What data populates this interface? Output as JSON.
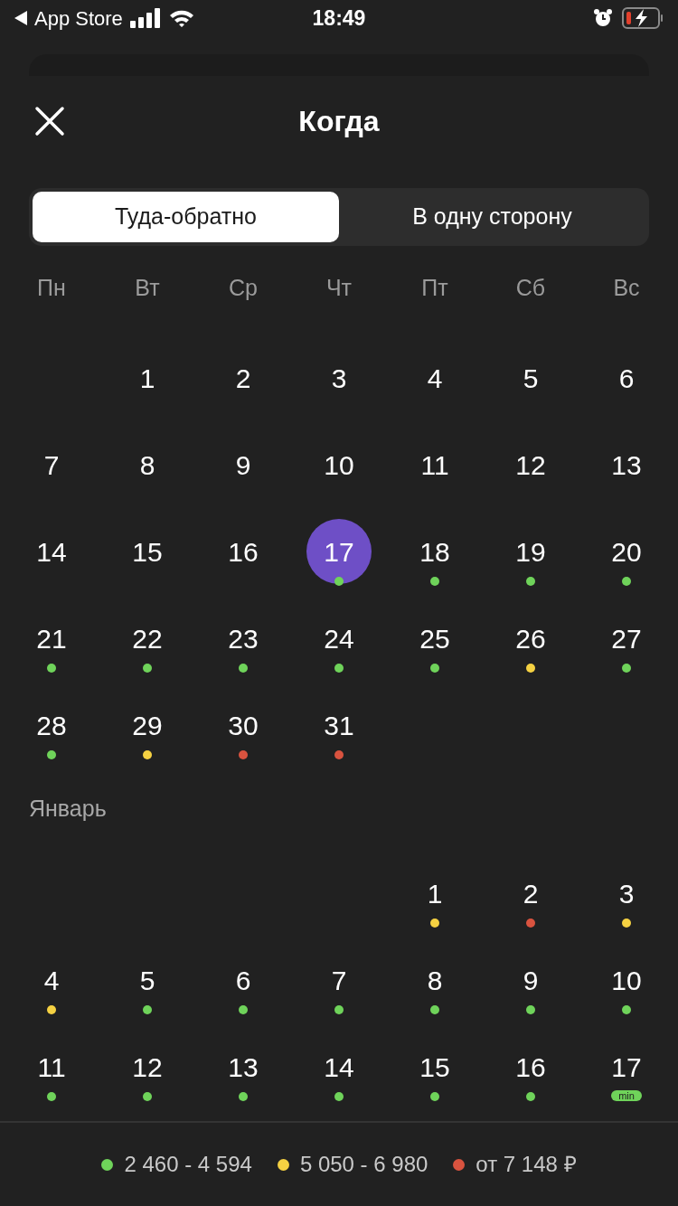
{
  "status_bar": {
    "back_label": "App Store",
    "time": "18:49"
  },
  "header": {
    "title": "Когда"
  },
  "trip_tabs": [
    {
      "label": "Туда-обратно",
      "selected": true
    },
    {
      "label": "В одну сторону",
      "selected": false
    }
  ],
  "weekdays": [
    "Пн",
    "Вт",
    "Ср",
    "Чт",
    "Пт",
    "Сб",
    "Вс"
  ],
  "months": [
    {
      "days": [
        {
          "kind": "blank"
        },
        {
          "kind": "day",
          "day": "1",
          "selected": false
        },
        {
          "kind": "day",
          "day": "2",
          "selected": false
        },
        {
          "kind": "day",
          "day": "3",
          "selected": false
        },
        {
          "kind": "day",
          "day": "4",
          "selected": false
        },
        {
          "kind": "day",
          "day": "5",
          "selected": false
        },
        {
          "kind": "day",
          "day": "6",
          "selected": false
        },
        {
          "kind": "day",
          "day": "7",
          "selected": false
        },
        {
          "kind": "day",
          "day": "8",
          "selected": false
        },
        {
          "kind": "day",
          "day": "9",
          "selected": false
        },
        {
          "kind": "day",
          "day": "10",
          "selected": false
        },
        {
          "kind": "day",
          "day": "11",
          "selected": false
        },
        {
          "kind": "day",
          "day": "12",
          "selected": false
        },
        {
          "kind": "day",
          "day": "13",
          "selected": false
        },
        {
          "kind": "day",
          "day": "14",
          "selected": false
        },
        {
          "kind": "day",
          "day": "15",
          "selected": false
        },
        {
          "kind": "day",
          "day": "16",
          "selected": false
        },
        {
          "kind": "day",
          "day": "17",
          "selected": true,
          "color": "#6fd35a"
        },
        {
          "kind": "day",
          "day": "18",
          "selected": false,
          "color": "#6fd35a"
        },
        {
          "kind": "day",
          "day": "19",
          "selected": false,
          "color": "#6fd35a"
        },
        {
          "kind": "day",
          "day": "20",
          "selected": false,
          "color": "#6fd35a"
        },
        {
          "kind": "day",
          "day": "21",
          "selected": false,
          "color": "#6fd35a"
        },
        {
          "kind": "day",
          "day": "22",
          "selected": false,
          "color": "#6fd35a"
        },
        {
          "kind": "day",
          "day": "23",
          "selected": false,
          "color": "#6fd35a"
        },
        {
          "kind": "day",
          "day": "24",
          "selected": false,
          "color": "#6fd35a"
        },
        {
          "kind": "day",
          "day": "25",
          "selected": false,
          "color": "#6fd35a"
        },
        {
          "kind": "day",
          "day": "26",
          "selected": false,
          "color": "#f5d142"
        },
        {
          "kind": "day",
          "day": "27",
          "selected": false,
          "color": "#6fd35a"
        },
        {
          "kind": "day",
          "day": "28",
          "selected": false,
          "color": "#6fd35a"
        },
        {
          "kind": "day",
          "day": "29",
          "selected": false,
          "color": "#f5d142"
        },
        {
          "kind": "day",
          "day": "30",
          "selected": false,
          "color": "#d9533f"
        },
        {
          "kind": "day",
          "day": "31",
          "selected": false,
          "color": "#d9533f"
        }
      ]
    },
    {
      "title": "Январь",
      "days": [
        {
          "kind": "blank"
        },
        {
          "kind": "blank"
        },
        {
          "kind": "blank"
        },
        {
          "kind": "blank"
        },
        {
          "kind": "day",
          "day": "1",
          "selected": false,
          "color": "#f5d142"
        },
        {
          "kind": "day",
          "day": "2",
          "selected": false,
          "color": "#d9533f"
        },
        {
          "kind": "day",
          "day": "3",
          "selected": false,
          "color": "#f5d142"
        },
        {
          "kind": "day",
          "day": "4",
          "selected": false,
          "color": "#f5d142"
        },
        {
          "kind": "day",
          "day": "5",
          "selected": false,
          "color": "#6fd35a"
        },
        {
          "kind": "day",
          "day": "6",
          "selected": false,
          "color": "#6fd35a"
        },
        {
          "kind": "day",
          "day": "7",
          "selected": false,
          "color": "#6fd35a"
        },
        {
          "kind": "day",
          "day": "8",
          "selected": false,
          "color": "#6fd35a"
        },
        {
          "kind": "day",
          "day": "9",
          "selected": false,
          "color": "#6fd35a"
        },
        {
          "kind": "day",
          "day": "10",
          "selected": false,
          "color": "#6fd35a"
        },
        {
          "kind": "day",
          "day": "11",
          "selected": false,
          "color": "#6fd35a"
        },
        {
          "kind": "day",
          "day": "12",
          "selected": false,
          "color": "#6fd35a"
        },
        {
          "kind": "day",
          "day": "13",
          "selected": false,
          "color": "#6fd35a"
        },
        {
          "kind": "day",
          "day": "14",
          "selected": false,
          "color": "#6fd35a"
        },
        {
          "kind": "day",
          "day": "15",
          "selected": false,
          "color": "#6fd35a"
        },
        {
          "kind": "day",
          "day": "16",
          "selected": false,
          "color": "#6fd35a"
        },
        {
          "kind": "day",
          "day": "17",
          "selected": false,
          "color": "#6fd35a",
          "badge": "min"
        }
      ]
    }
  ],
  "legend": [
    {
      "color": "#6fd35a",
      "label": "2 460 - 4 594"
    },
    {
      "color": "#f5d142",
      "label": "5 050 - 6 980"
    },
    {
      "color": "#d9533f",
      "label": "от 7 148 ₽"
    }
  ]
}
